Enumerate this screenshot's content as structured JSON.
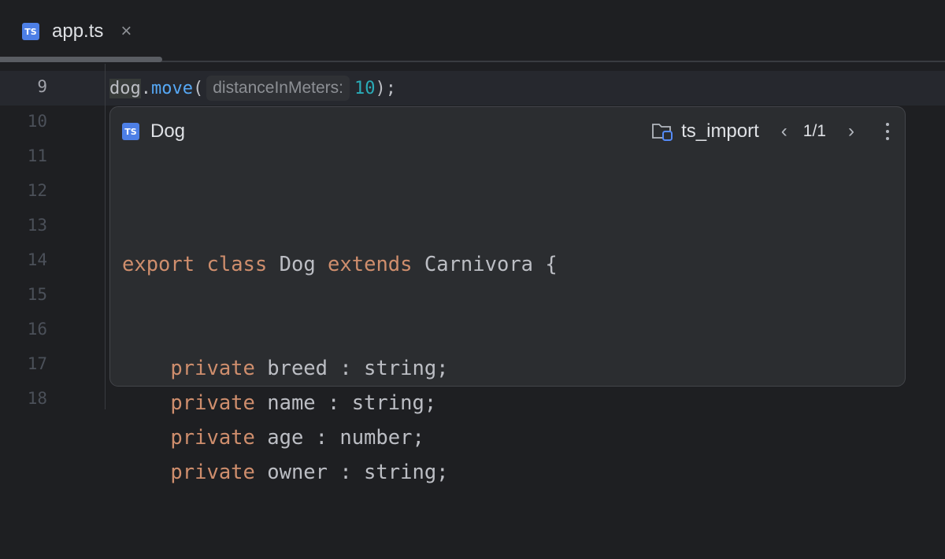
{
  "tab": {
    "icon": "TS",
    "label": "app.ts",
    "close": "×"
  },
  "editor": {
    "line_numbers": [
      "9",
      "10",
      "11",
      "12",
      "13",
      "14",
      "15",
      "16",
      "17",
      "18"
    ],
    "current_line": {
      "receiver": "dog",
      "dot": ".",
      "method": "move",
      "open": "(",
      "hint": "distanceInMeters:",
      "arg": "10",
      "close": ");"
    }
  },
  "popup": {
    "icon": "TS",
    "title": "Dog",
    "module": "ts_import",
    "prev": "‹",
    "next": "›",
    "count": "1/1",
    "code": [
      {
        "indent": "",
        "kw": "export",
        "rest": " "
      },
      {
        "indent": "    ",
        "kw": "private",
        "rest": " breed : string;"
      },
      {
        "indent": "    ",
        "kw": "private",
        "rest": " name : string;"
      },
      {
        "indent": "    ",
        "kw": "private",
        "rest": " age : number;"
      },
      {
        "indent": "    ",
        "kw": "private",
        "rest": " owner : string;"
      }
    ],
    "line1": {
      "kw1": "export",
      "kw2": "class",
      "name": "Dog",
      "kw3": "extends",
      "base": "Carnivora {"
    }
  }
}
